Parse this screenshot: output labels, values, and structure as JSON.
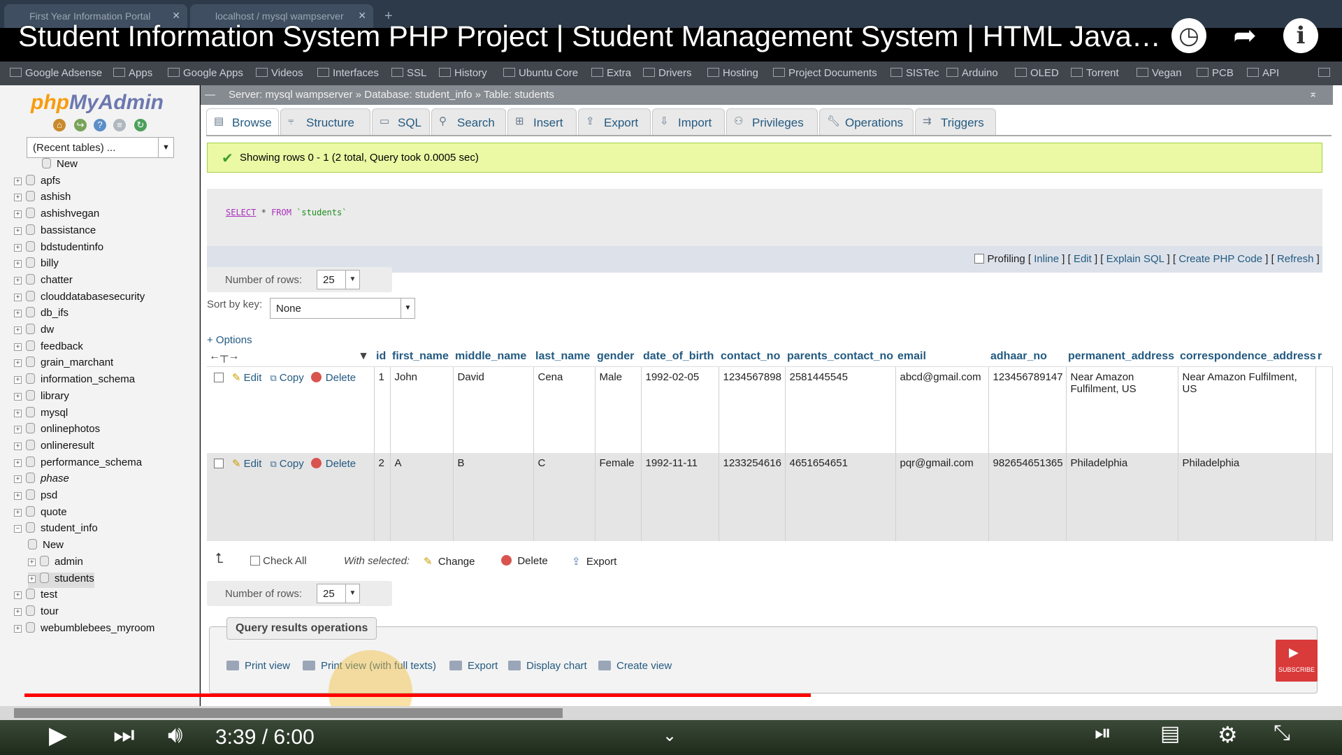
{
  "browser": {
    "tabs": [
      {
        "title": "First Year Information Portal"
      },
      {
        "title": "localhost / mysql wampserver"
      }
    ],
    "bookmarks": [
      "Google Adsense",
      "Apps",
      "Google Apps",
      "Videos",
      "Interfaces",
      "SSL",
      "History",
      "Ubuntu Core",
      "Extra",
      "Drivers",
      "Hosting",
      "Project Documents",
      "SISTec",
      "Arduino",
      "OLED",
      "Torrent",
      "Vegan",
      "PCB",
      "API"
    ]
  },
  "video": {
    "title": "Student Information System PHP Project | Student Management System | HTML JavaScri...",
    "time": "3:39 / 6:00",
    "progress_fraction": 0.608,
    "buffered_fraction": 0.695,
    "subscribe_label": "SUBSCRIBE"
  },
  "sidebar": {
    "logo_php": "php",
    "logo_myadmin": "MyAdmin",
    "recent_tables": "(Recent tables) ...",
    "databases": [
      {
        "label": "New",
        "indent": 1
      },
      {
        "label": "apfs",
        "indent": 0
      },
      {
        "label": "ashish",
        "indent": 0
      },
      {
        "label": "ashishvegan",
        "indent": 0
      },
      {
        "label": "bassistance",
        "indent": 0
      },
      {
        "label": "bdstudentinfo",
        "indent": 0
      },
      {
        "label": "billy",
        "indent": 0
      },
      {
        "label": "chatter",
        "indent": 0
      },
      {
        "label": "clouddatabasesecurity",
        "indent": 0
      },
      {
        "label": "db_ifs",
        "indent": 0
      },
      {
        "label": "dw",
        "indent": 0
      },
      {
        "label": "feedback",
        "indent": 0
      },
      {
        "label": "grain_marchant",
        "indent": 0
      },
      {
        "label": "information_schema",
        "indent": 0
      },
      {
        "label": "library",
        "indent": 0
      },
      {
        "label": "mysql",
        "indent": 0
      },
      {
        "label": "onlinephotos",
        "indent": 0
      },
      {
        "label": "onlineresult",
        "indent": 0
      },
      {
        "label": "performance_schema",
        "indent": 0
      },
      {
        "label": "phase",
        "indent": 0
      },
      {
        "label": "psd",
        "indent": 0
      },
      {
        "label": "quote",
        "indent": 0
      },
      {
        "label": "student_info",
        "indent": 0
      },
      {
        "label": "New",
        "indent": 1
      },
      {
        "label": "admin",
        "indent": 1
      },
      {
        "label": "students",
        "indent": 1
      },
      {
        "label": "test",
        "indent": 0
      },
      {
        "label": "tour",
        "indent": 0
      },
      {
        "label": "webumblebees_myroom",
        "indent": 0
      }
    ]
  },
  "breadcrumb": {
    "server": "Server: mysql wampserver",
    "sep1": "»",
    "database": "Database: student_info",
    "sep2": "»",
    "table": "Table: students"
  },
  "tabs": [
    "Browse",
    "Structure",
    "SQL",
    "Search",
    "Insert",
    "Export",
    "Import",
    "Privileges",
    "Operations",
    "Triggers"
  ],
  "success_message": "Showing rows 0 - 1 (2 total, Query took 0.0005 sec)",
  "sql": {
    "select": "SELECT",
    "star": "*",
    "from": "FROM",
    "table": "`students`"
  },
  "profiling": {
    "label": "Profiling",
    "links": [
      "Inline",
      "Edit",
      "Explain SQL",
      "Create PHP Code",
      "Refresh"
    ]
  },
  "number_of_rows_label": "Number of rows:",
  "number_of_rows_value": "25",
  "sort_by_key_label": "Sort by key:",
  "sort_by_key_value": "None",
  "options_label": "+ Options",
  "columns": [
    "id",
    "first_name",
    "middle_name",
    "last_name",
    "gender",
    "date_of_birth",
    "contact_no",
    "parents_contact_no",
    "email",
    "adhaar_no",
    "permanent_address",
    "correspondence_address",
    "r"
  ],
  "row_actions": {
    "edit": "Edit",
    "copy": "Copy",
    "delete": "Delete"
  },
  "rows": [
    {
      "id": "1",
      "first_name": "John",
      "middle_name": "David",
      "last_name": "Cena",
      "gender": "Male",
      "date_of_birth": "1992-02-05",
      "contact_no": "1234567898",
      "parents_contact_no": "2581445545",
      "email": "abcd@gmail.com",
      "adhaar_no": "123456789147",
      "permanent_address": "Near Amazon Fulfilment, US",
      "correspondence_address": "Near Amazon Fulfilment, US"
    },
    {
      "id": "2",
      "first_name": "A",
      "middle_name": "B",
      "last_name": "C",
      "gender": "Female",
      "date_of_birth": "1992-11-11",
      "contact_no": "1233254616",
      "parents_contact_no": "4651654651",
      "email": "pqr@gmail.com",
      "adhaar_no": "982654651365",
      "permanent_address": "Philadelphia",
      "correspondence_address": "Philadelphia"
    }
  ],
  "bulk": {
    "check_all": "Check All",
    "with_selected": "With selected:",
    "change": "Change",
    "delete": "Delete",
    "export": "Export"
  },
  "query_ops": {
    "legend": "Query results operations",
    "items": [
      "Print view",
      "Print view (with full texts)",
      "Export",
      "Display chart",
      "Create view"
    ]
  }
}
